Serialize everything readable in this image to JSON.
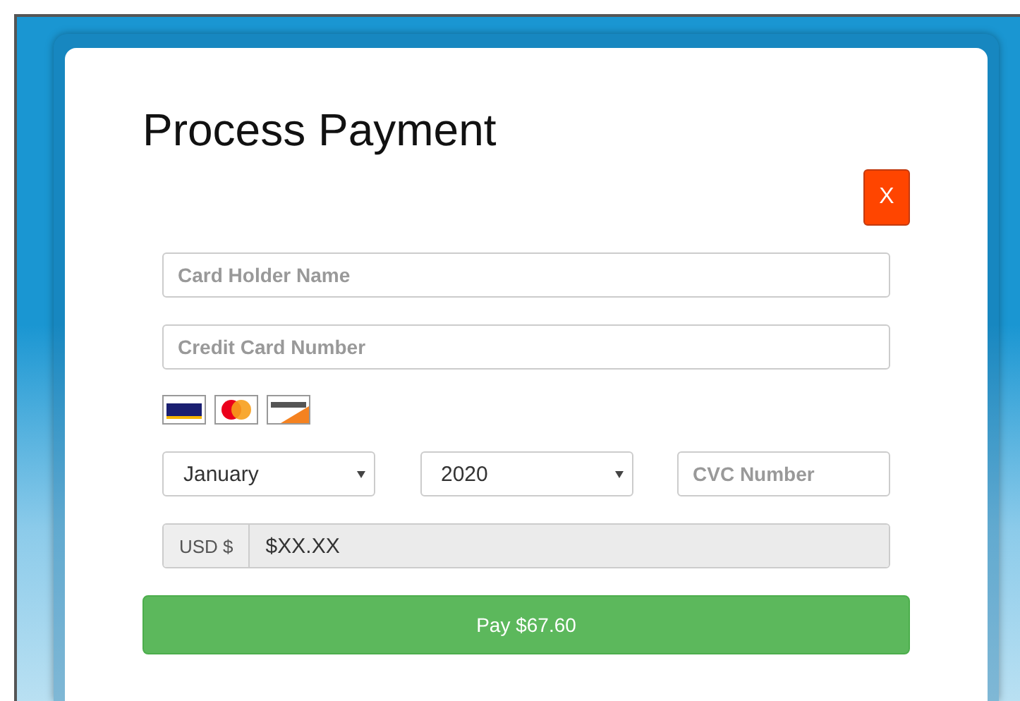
{
  "dialog": {
    "title": "Process Payment",
    "close_button": "X"
  },
  "fields": [
    {
      "placeholder": "Card Holder Name"
    },
    {
      "placeholder": "Credit Card Number"
    }
  ],
  "expiry": {
    "month": "January",
    "year": "2020"
  },
  "cvc": {
    "placeholder": "CVC Number"
  },
  "amount": {
    "currency": "USD $",
    "value": "$XX.XX",
    "disabled": true
  },
  "pay_button": "Pay $67.60"
}
